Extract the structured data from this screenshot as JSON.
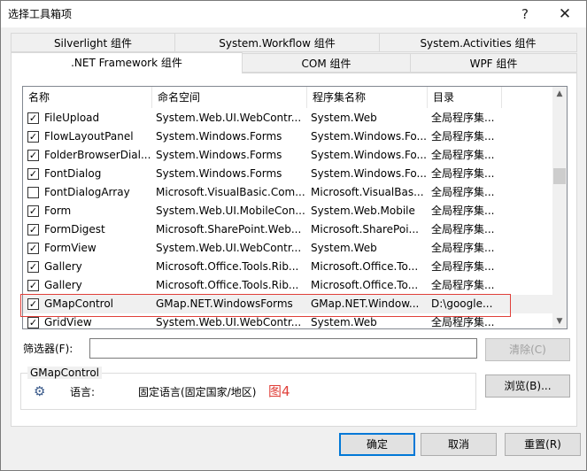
{
  "window": {
    "title": "选择工具箱项",
    "help": "?",
    "close": "✕"
  },
  "tabs_back": [
    "Silverlight 组件",
    "System.Workflow 组件",
    "System.Activities 组件"
  ],
  "tabs_front": [
    ".NET Framework 组件",
    "COM 组件",
    "WPF 组件"
  ],
  "columns": [
    "名称",
    "命名空间",
    "程序集名称",
    "目录"
  ],
  "rows": [
    {
      "checked": true,
      "name": "FileUpload",
      "ns": "System.Web.UI.WebContr...",
      "asm": "System.Web",
      "dir": "全局程序集..."
    },
    {
      "checked": true,
      "name": "FlowLayoutPanel",
      "ns": "System.Windows.Forms",
      "asm": "System.Windows.Fo...",
      "dir": "全局程序集..."
    },
    {
      "checked": true,
      "name": "FolderBrowserDial...",
      "ns": "System.Windows.Forms",
      "asm": "System.Windows.Fo...",
      "dir": "全局程序集..."
    },
    {
      "checked": true,
      "name": "FontDialog",
      "ns": "System.Windows.Forms",
      "asm": "System.Windows.Fo...",
      "dir": "全局程序集..."
    },
    {
      "checked": false,
      "name": "FontDialogArray",
      "ns": "Microsoft.VisualBasic.Com...",
      "asm": "Microsoft.VisualBas...",
      "dir": "全局程序集..."
    },
    {
      "checked": true,
      "name": "Form",
      "ns": "System.Web.UI.MobileCon...",
      "asm": "System.Web.Mobile",
      "dir": "全局程序集..."
    },
    {
      "checked": true,
      "name": "FormDigest",
      "ns": "Microsoft.SharePoint.Web...",
      "asm": "Microsoft.SharePoi...",
      "dir": "全局程序集..."
    },
    {
      "checked": true,
      "name": "FormView",
      "ns": "System.Web.UI.WebContr...",
      "asm": "System.Web",
      "dir": "全局程序集..."
    },
    {
      "checked": true,
      "name": "Gallery",
      "ns": "Microsoft.Office.Tools.Rib...",
      "asm": "Microsoft.Office.To...",
      "dir": "全局程序集..."
    },
    {
      "checked": true,
      "name": "Gallery",
      "ns": "Microsoft.Office.Tools.Rib...",
      "asm": "Microsoft.Office.To...",
      "dir": "全局程序集..."
    },
    {
      "checked": true,
      "name": "GMapControl",
      "ns": "GMap.NET.WindowsForms",
      "asm": "GMap.NET.Window...",
      "dir": "D:\\google..."
    },
    {
      "checked": true,
      "name": "GridView",
      "ns": "System.Web.UI.WebContr...",
      "asm": "System.Web",
      "dir": "全局程序集..."
    }
  ],
  "filter": {
    "label": "筛选器(F):",
    "value": "",
    "clear": "清除(C)"
  },
  "details": {
    "group_title": "GMapControl",
    "lang_label": "语言:",
    "lang_value": "固定语言(固定国家/地区)",
    "annotation": "图4"
  },
  "browse": "浏览(B)...",
  "buttons": {
    "ok": "确定",
    "cancel": "取消",
    "reset": "重置(R)"
  },
  "colors": {
    "accent": "#0078d7",
    "annotation": "#e0403a"
  }
}
